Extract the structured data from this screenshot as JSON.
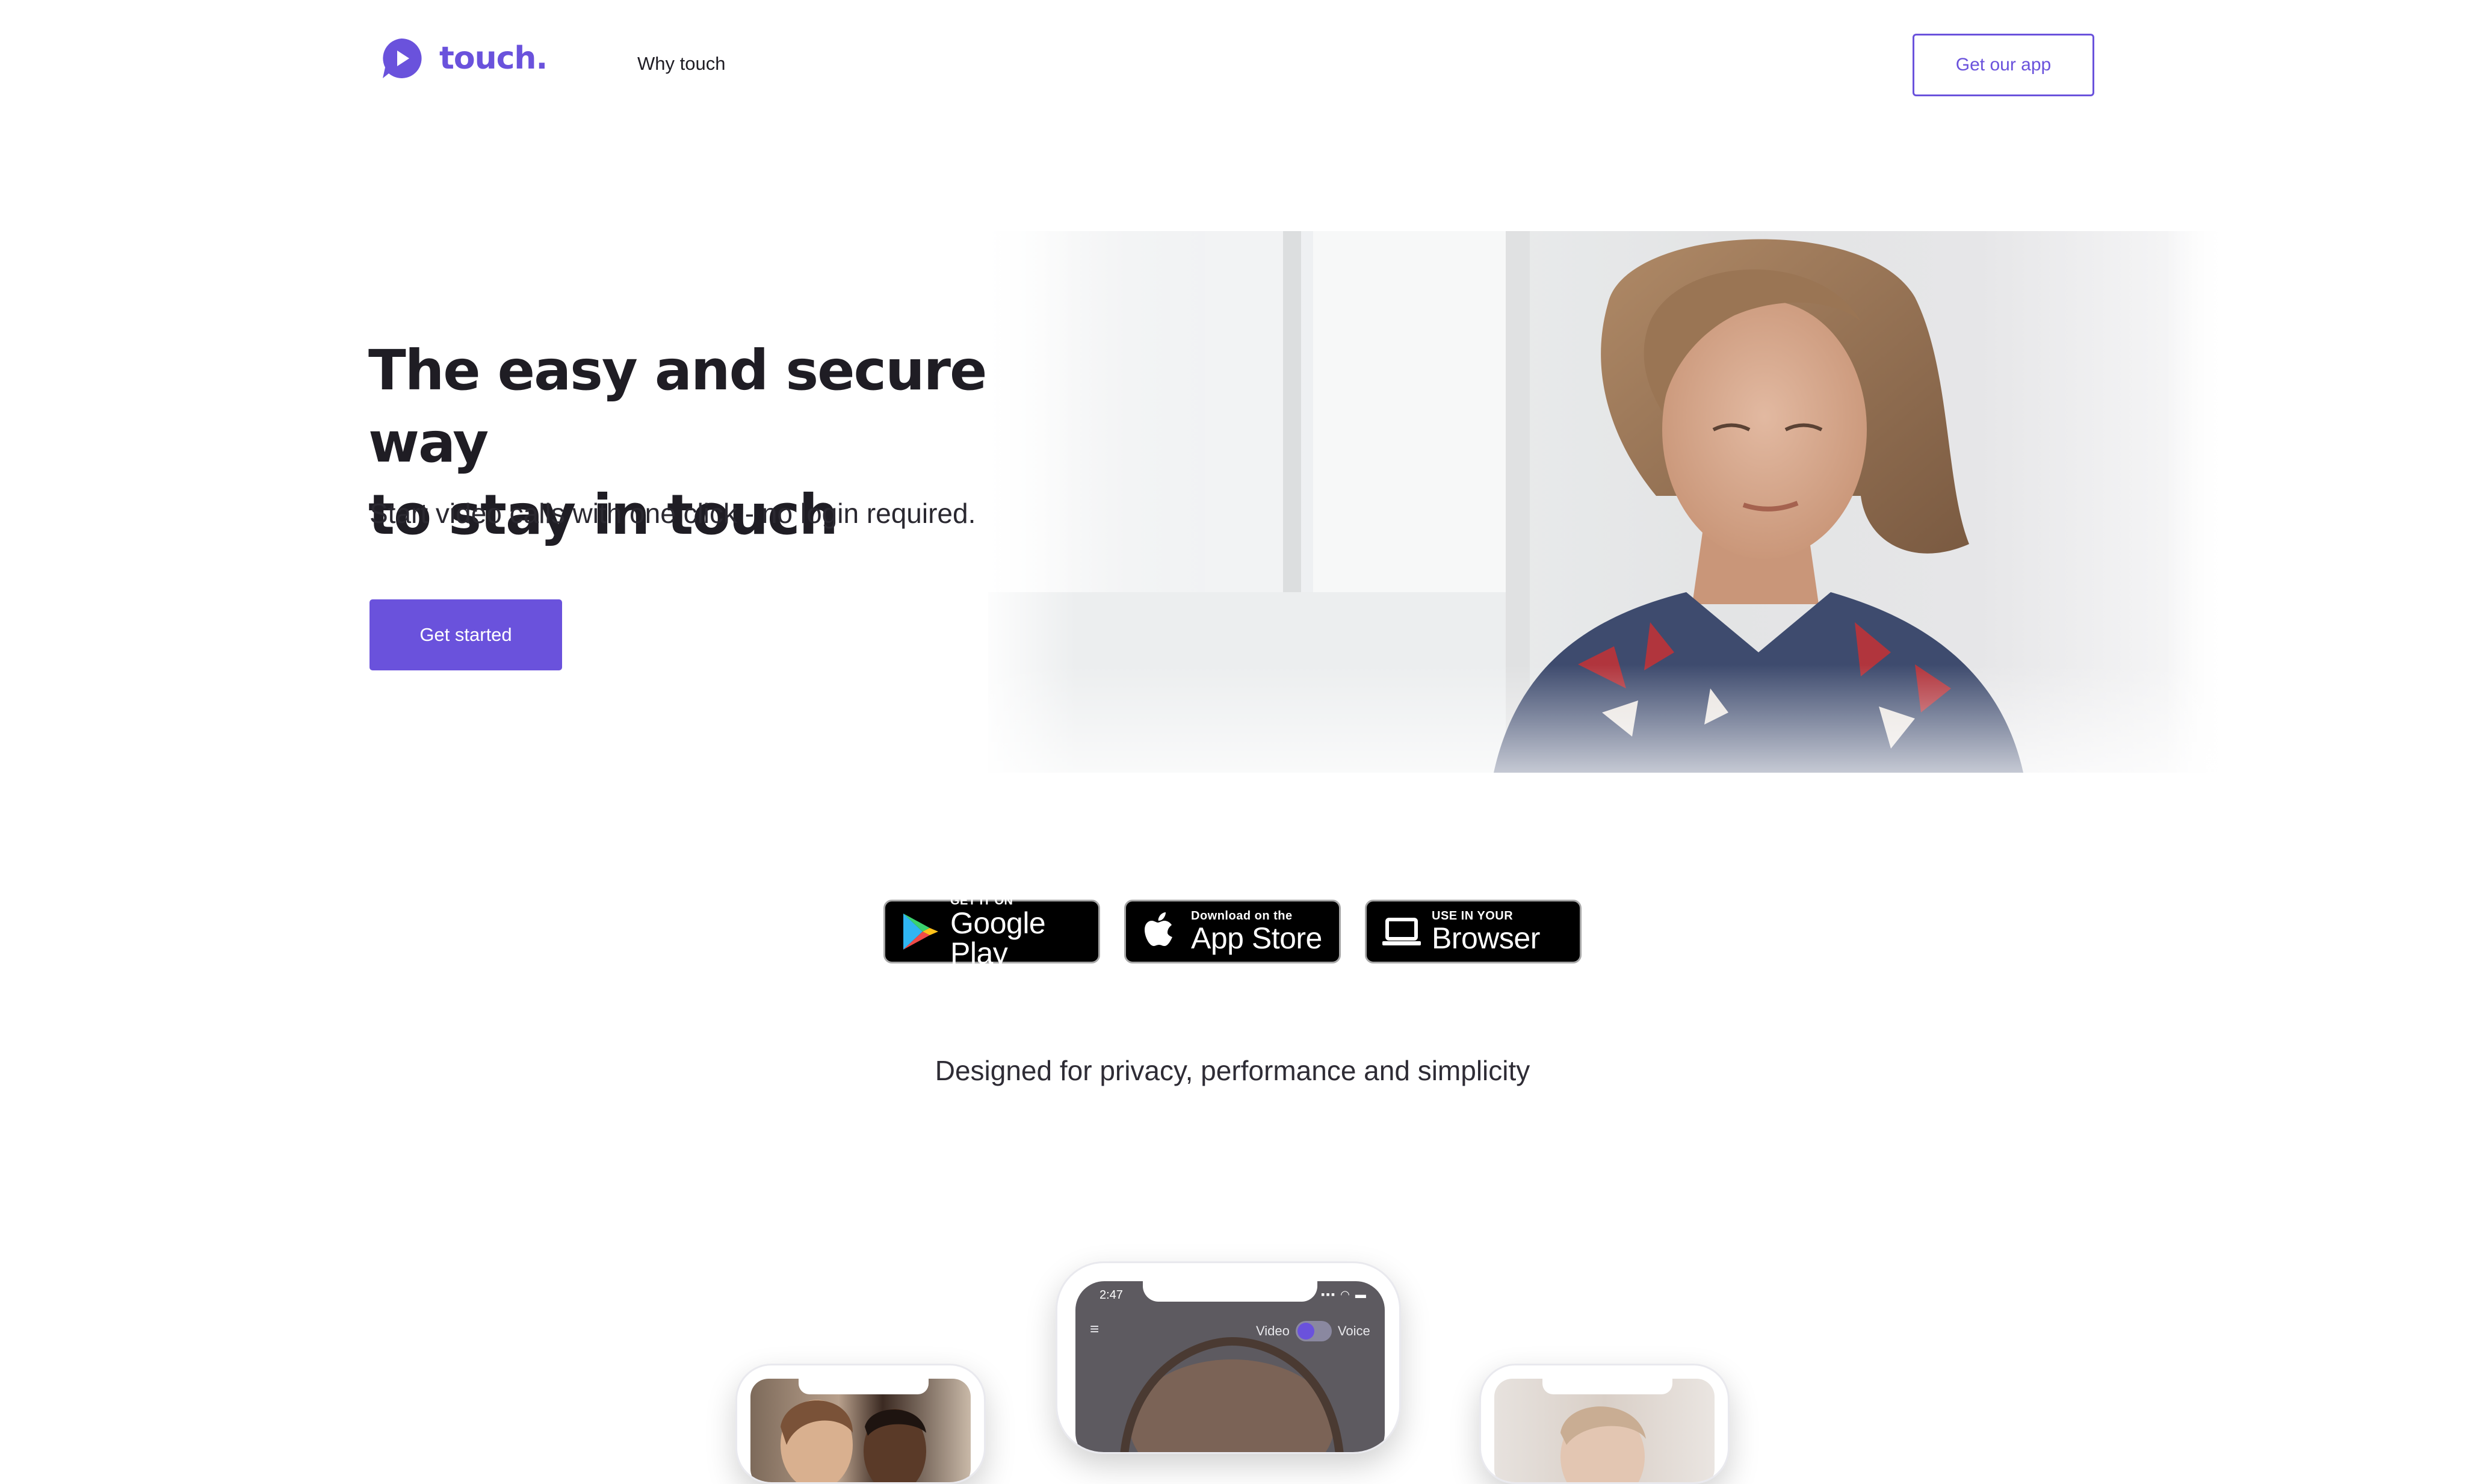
{
  "header": {
    "logo_text": "touch.",
    "nav_why": "Why touch",
    "get_app_button": "Get our app"
  },
  "hero": {
    "title_line1": "The easy and secure way",
    "title_line2": "to stay in touch",
    "subtitle": "Start video calls with one click - no login required.",
    "cta_button": "Get started"
  },
  "badges": [
    {
      "icon": "google-play-icon",
      "small": "GET IT ON",
      "big": "Google Play"
    },
    {
      "icon": "apple-icon",
      "small": "Download on the",
      "big": "App Store"
    },
    {
      "icon": "laptop-icon",
      "small": "USE IN YOUR",
      "big": "Browser"
    }
  ],
  "tagline": "Designed for privacy, performance and simplicity",
  "phone_center": {
    "time": "2:47",
    "video_label": "Video",
    "voice_label": "Voice"
  },
  "colors": {
    "brand": "#6a52dc",
    "text": "#1f1d24",
    "background": "#ffffff",
    "badge_bg": "#000000"
  }
}
